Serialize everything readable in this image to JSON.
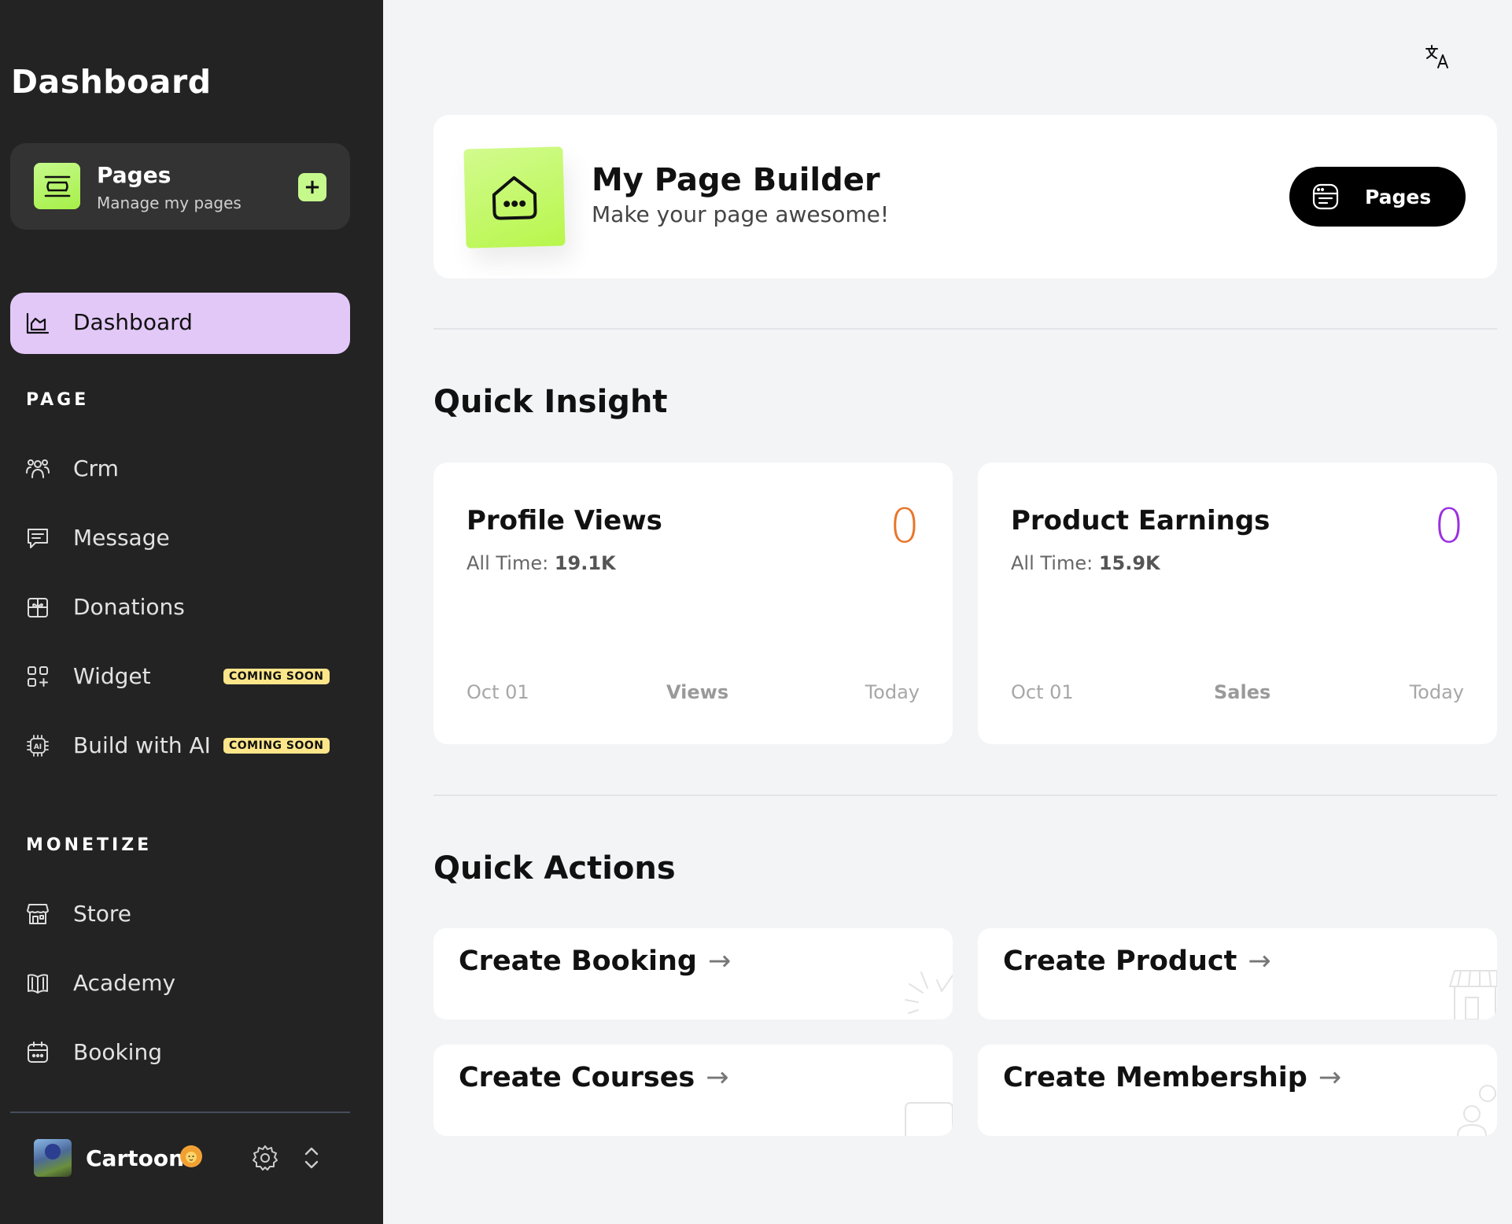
{
  "sidebar": {
    "title": "Dashboard",
    "pages_card": {
      "title": "Pages",
      "subtitle": "Manage my pages",
      "add_label": "+"
    },
    "active_item": {
      "label": "Dashboard",
      "icon": "chart-area-icon"
    },
    "section_page": "PAGE",
    "section_monetize": "MONETIZE",
    "page_items": [
      {
        "label": "Crm",
        "icon": "users-icon"
      },
      {
        "label": "Message",
        "icon": "message-icon"
      },
      {
        "label": "Donations",
        "icon": "gift-icon"
      },
      {
        "label": "Widget",
        "icon": "widget-icon",
        "badge": "COMING SOON"
      },
      {
        "label": "Build with AI",
        "icon": "ai-chip-icon",
        "badge": "COMING SOON"
      }
    ],
    "monetize_items": [
      {
        "label": "Store",
        "icon": "store-icon"
      },
      {
        "label": "Academy",
        "icon": "book-icon"
      },
      {
        "label": "Booking",
        "icon": "calendar-icon"
      }
    ],
    "user": {
      "name": "Cartoon"
    }
  },
  "hero": {
    "title": "My Page Builder",
    "subtitle": "Make your page awesome!",
    "button_label": "Pages"
  },
  "quick_insight": {
    "title": "Quick Insight",
    "cards": [
      {
        "title": "Profile Views",
        "all_time_label": "All Time:",
        "all_time_value": "19.1K",
        "value": "0",
        "value_color": "#e8762b",
        "foot_start": "Oct 01",
        "foot_mid": "Views",
        "foot_end": "Today"
      },
      {
        "title": "Product Earnings",
        "all_time_label": "All Time:",
        "all_time_value": "15.9K",
        "value": "0",
        "value_color": "#9b30e0",
        "foot_start": "Oct 01",
        "foot_mid": "Sales",
        "foot_end": "Today"
      }
    ]
  },
  "quick_actions": {
    "title": "Quick Actions",
    "items": [
      {
        "label": "Create Booking",
        "arrow": "→"
      },
      {
        "label": "Create Product",
        "arrow": "→"
      },
      {
        "label": "Create Courses",
        "arrow": "→"
      },
      {
        "label": "Create Membership",
        "arrow": "→"
      }
    ]
  },
  "colors": {
    "sidebar_bg": "#232323",
    "accent_green": "#c6f98c",
    "accent_purple": "#e2c8f7",
    "badge_yellow": "#fde68a"
  }
}
